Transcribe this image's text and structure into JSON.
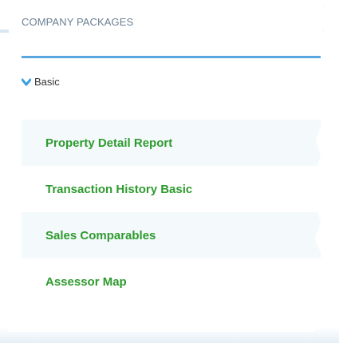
{
  "panel": {
    "title": "COMPANY PACKAGES",
    "group": {
      "label": "Basic",
      "expanded": true,
      "icon": "chevron-down-icon",
      "icon_color": "#3aa0e0"
    },
    "items": [
      {
        "label": "Property Detail Report"
      },
      {
        "label": "Transaction History Basic"
      },
      {
        "label": "Sales Comparables"
      },
      {
        "label": "Assessor Map"
      }
    ],
    "colors": {
      "title": "#6c8093",
      "divider": "#5aa7e0",
      "link": "#2e9a2e",
      "row_alt_bg": "#f4f9fc"
    }
  }
}
